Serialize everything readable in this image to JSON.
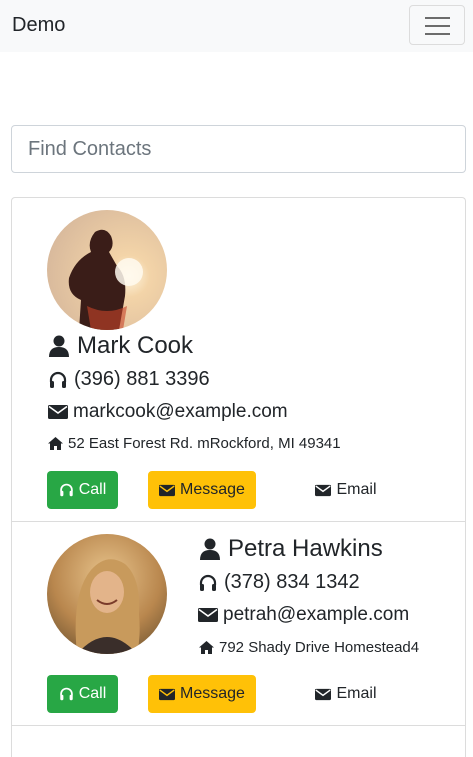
{
  "navbar": {
    "brand": "Demo",
    "menu_icon": "hamburger-icon"
  },
  "search": {
    "placeholder": "Find Contacts",
    "value": ""
  },
  "contacts": [
    {
      "name": "Mark Cook",
      "phone": "(396) 881 3396",
      "email": "markcook@example.com",
      "address": "52 East Forest Rd. mRockford, MI 49341",
      "actions": {
        "call": "Call",
        "message": "Message",
        "email": "Email"
      }
    },
    {
      "name": "Petra Hawkins",
      "phone": "(378) 834 1342",
      "email": "petrah@example.com",
      "address": "792 Shady Drive Homestead4",
      "actions": {
        "call": "Call",
        "message": "Message",
        "email": "Email"
      }
    }
  ],
  "colors": {
    "call": "#28a745",
    "message": "#ffc107",
    "navbar": "#f8f9fa"
  }
}
